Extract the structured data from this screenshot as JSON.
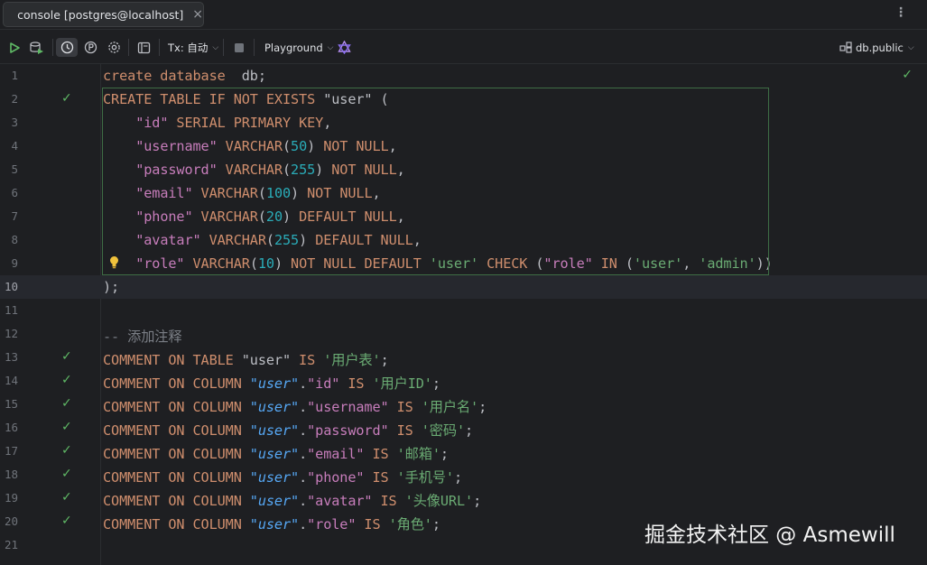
{
  "tab": {
    "label": "console [postgres@localhost]",
    "close": "×"
  },
  "toolbar": {
    "tx_label": "Tx: 自动",
    "playground_label": "Playground",
    "schema_label": "db.public",
    "chevron": "⌵"
  },
  "icons": {
    "more": "more-vertical-icon",
    "run": "run-icon",
    "explain": "explain-plan-icon",
    "history": "history-icon",
    "parameters": "parameters-icon",
    "settings": "gear-icon",
    "output": "output-layout-icon",
    "stop": "stop-icon",
    "ai": "ai-assistant-icon",
    "schema": "schema-icon",
    "check": "check-icon",
    "bulb": "lightbulb-icon"
  },
  "colors": {
    "accent_green": "#5fb865",
    "keyword": "#cf8e6d",
    "string": "#6aab73",
    "number": "#2aacb8",
    "comment": "#7a7e85"
  },
  "editor": {
    "lines": [
      {
        "n": "1",
        "checked": false,
        "tokens": [
          {
            "t": "create database",
            "c": "kw"
          },
          {
            "t": "  db;",
            "c": ""
          }
        ]
      },
      {
        "n": "2",
        "checked": true,
        "tokens": [
          {
            "t": "CREATE TABLE IF NOT EXISTS ",
            "c": "kw"
          },
          {
            "t": "\"user\"",
            "c": ""
          },
          {
            "t": " (",
            "c": ""
          }
        ]
      },
      {
        "n": "3",
        "checked": false,
        "tokens": [
          {
            "t": "    ",
            "c": ""
          },
          {
            "t": "\"id\"",
            "c": "id"
          },
          {
            "t": " SERIAL PRIMARY KEY",
            "c": "kw"
          },
          {
            "t": ",",
            "c": ""
          }
        ]
      },
      {
        "n": "4",
        "checked": false,
        "tokens": [
          {
            "t": "    ",
            "c": ""
          },
          {
            "t": "\"username\"",
            "c": "id"
          },
          {
            "t": " VARCHAR",
            "c": "kw"
          },
          {
            "t": "(",
            "c": ""
          },
          {
            "t": "50",
            "c": "num"
          },
          {
            "t": ") ",
            "c": ""
          },
          {
            "t": "NOT NULL",
            "c": "kw"
          },
          {
            "t": ",",
            "c": ""
          }
        ]
      },
      {
        "n": "5",
        "checked": false,
        "tokens": [
          {
            "t": "    ",
            "c": ""
          },
          {
            "t": "\"password\"",
            "c": "id"
          },
          {
            "t": " VARCHAR",
            "c": "kw"
          },
          {
            "t": "(",
            "c": ""
          },
          {
            "t": "255",
            "c": "num"
          },
          {
            "t": ") ",
            "c": ""
          },
          {
            "t": "NOT NULL",
            "c": "kw"
          },
          {
            "t": ",",
            "c": ""
          }
        ]
      },
      {
        "n": "6",
        "checked": false,
        "tokens": [
          {
            "t": "    ",
            "c": ""
          },
          {
            "t": "\"email\"",
            "c": "id"
          },
          {
            "t": " VARCHAR",
            "c": "kw"
          },
          {
            "t": "(",
            "c": ""
          },
          {
            "t": "100",
            "c": "num"
          },
          {
            "t": ") ",
            "c": ""
          },
          {
            "t": "NOT NULL",
            "c": "kw"
          },
          {
            "t": ",",
            "c": ""
          }
        ]
      },
      {
        "n": "7",
        "checked": false,
        "tokens": [
          {
            "t": "    ",
            "c": ""
          },
          {
            "t": "\"phone\"",
            "c": "id"
          },
          {
            "t": " VARCHAR",
            "c": "kw"
          },
          {
            "t": "(",
            "c": ""
          },
          {
            "t": "20",
            "c": "num"
          },
          {
            "t": ") ",
            "c": ""
          },
          {
            "t": "DEFAULT NULL",
            "c": "kw"
          },
          {
            "t": ",",
            "c": ""
          }
        ]
      },
      {
        "n": "8",
        "checked": false,
        "tokens": [
          {
            "t": "    ",
            "c": ""
          },
          {
            "t": "\"avatar\"",
            "c": "id"
          },
          {
            "t": " VARCHAR",
            "c": "kw"
          },
          {
            "t": "(",
            "c": ""
          },
          {
            "t": "255",
            "c": "num"
          },
          {
            "t": ") ",
            "c": ""
          },
          {
            "t": "DEFAULT NULL",
            "c": "kw"
          },
          {
            "t": ",",
            "c": ""
          }
        ]
      },
      {
        "n": "9",
        "checked": false,
        "bulb": true,
        "tokens": [
          {
            "t": "    ",
            "c": ""
          },
          {
            "t": "\"role\"",
            "c": "id"
          },
          {
            "t": " VARCHAR",
            "c": "kw"
          },
          {
            "t": "(",
            "c": ""
          },
          {
            "t": "10",
            "c": "num"
          },
          {
            "t": ") ",
            "c": ""
          },
          {
            "t": "NOT NULL DEFAULT ",
            "c": "kw"
          },
          {
            "t": "'user'",
            "c": "str"
          },
          {
            "t": " CHECK ",
            "c": "kw"
          },
          {
            "t": "(",
            "c": ""
          },
          {
            "t": "\"role\"",
            "c": "id"
          },
          {
            "t": " IN ",
            "c": "kw"
          },
          {
            "t": "(",
            "c": ""
          },
          {
            "t": "'user'",
            "c": "str"
          },
          {
            "t": ", ",
            "c": ""
          },
          {
            "t": "'admin'",
            "c": "str"
          },
          {
            "t": "))",
            "c": ""
          }
        ]
      },
      {
        "n": "10",
        "checked": false,
        "current": true,
        "tokens": [
          {
            "t": ");",
            "c": ""
          }
        ]
      },
      {
        "n": "11",
        "checked": false,
        "tokens": []
      },
      {
        "n": "12",
        "checked": false,
        "tokens": [
          {
            "t": "-- 添加注释",
            "c": "cm"
          }
        ]
      },
      {
        "n": "13",
        "checked": true,
        "tokens": [
          {
            "t": "COMMENT ON TABLE ",
            "c": "kw"
          },
          {
            "t": "\"user\"",
            "c": ""
          },
          {
            "t": " IS ",
            "c": "kw"
          },
          {
            "t": "'用户表'",
            "c": "str"
          },
          {
            "t": ";",
            "c": ""
          }
        ]
      },
      {
        "n": "14",
        "checked": true,
        "tokens": [
          {
            "t": "COMMENT ON COLUMN ",
            "c": "kw"
          },
          {
            "t": "\"user\"",
            "c": "itl"
          },
          {
            "t": ".",
            "c": ""
          },
          {
            "t": "\"id\"",
            "c": "id"
          },
          {
            "t": " IS ",
            "c": "kw"
          },
          {
            "t": "'用户ID'",
            "c": "str"
          },
          {
            "t": ";",
            "c": ""
          }
        ]
      },
      {
        "n": "15",
        "checked": true,
        "tokens": [
          {
            "t": "COMMENT ON COLUMN ",
            "c": "kw"
          },
          {
            "t": "\"user\"",
            "c": "itl"
          },
          {
            "t": ".",
            "c": ""
          },
          {
            "t": "\"username\"",
            "c": "id"
          },
          {
            "t": " IS ",
            "c": "kw"
          },
          {
            "t": "'用户名'",
            "c": "str"
          },
          {
            "t": ";",
            "c": ""
          }
        ]
      },
      {
        "n": "16",
        "checked": true,
        "tokens": [
          {
            "t": "COMMENT ON COLUMN ",
            "c": "kw"
          },
          {
            "t": "\"user\"",
            "c": "itl"
          },
          {
            "t": ".",
            "c": ""
          },
          {
            "t": "\"password\"",
            "c": "id"
          },
          {
            "t": " IS ",
            "c": "kw"
          },
          {
            "t": "'密码'",
            "c": "str"
          },
          {
            "t": ";",
            "c": ""
          }
        ]
      },
      {
        "n": "17",
        "checked": true,
        "tokens": [
          {
            "t": "COMMENT ON COLUMN ",
            "c": "kw"
          },
          {
            "t": "\"user\"",
            "c": "itl"
          },
          {
            "t": ".",
            "c": ""
          },
          {
            "t": "\"email\"",
            "c": "id"
          },
          {
            "t": " IS ",
            "c": "kw"
          },
          {
            "t": "'邮箱'",
            "c": "str"
          },
          {
            "t": ";",
            "c": ""
          }
        ]
      },
      {
        "n": "18",
        "checked": true,
        "tokens": [
          {
            "t": "COMMENT ON COLUMN ",
            "c": "kw"
          },
          {
            "t": "\"user\"",
            "c": "itl"
          },
          {
            "t": ".",
            "c": ""
          },
          {
            "t": "\"phone\"",
            "c": "id"
          },
          {
            "t": " IS ",
            "c": "kw"
          },
          {
            "t": "'手机号'",
            "c": "str"
          },
          {
            "t": ";",
            "c": ""
          }
        ]
      },
      {
        "n": "19",
        "checked": true,
        "tokens": [
          {
            "t": "COMMENT ON COLUMN ",
            "c": "kw"
          },
          {
            "t": "\"user\"",
            "c": "itl"
          },
          {
            "t": ".",
            "c": ""
          },
          {
            "t": "\"avatar\"",
            "c": "id"
          },
          {
            "t": " IS ",
            "c": "kw"
          },
          {
            "t": "'头像URL'",
            "c": "str"
          },
          {
            "t": ";",
            "c": ""
          }
        ]
      },
      {
        "n": "20",
        "checked": true,
        "tokens": [
          {
            "t": "COMMENT ON COLUMN ",
            "c": "kw"
          },
          {
            "t": "\"user\"",
            "c": "itl"
          },
          {
            "t": ".",
            "c": ""
          },
          {
            "t": "\"role\"",
            "c": "id"
          },
          {
            "t": " IS ",
            "c": "kw"
          },
          {
            "t": "'角色'",
            "c": "str"
          },
          {
            "t": ";",
            "c": ""
          }
        ]
      },
      {
        "n": "21",
        "checked": false,
        "tokens": []
      }
    ]
  },
  "watermark": "掘金技术社区 @ Asmewill"
}
